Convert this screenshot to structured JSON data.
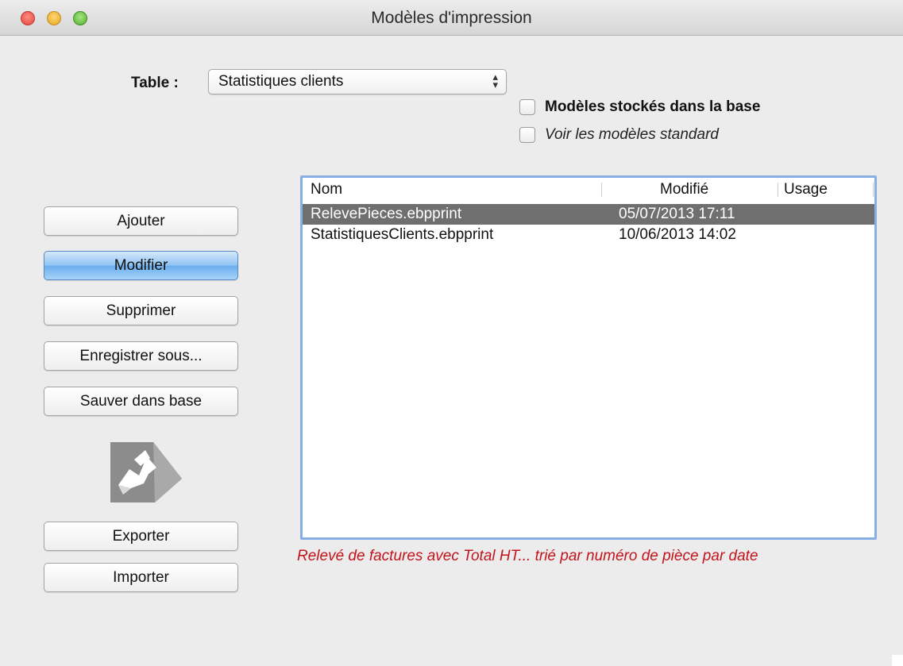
{
  "window": {
    "title": "Modèles d'impression"
  },
  "table_selector": {
    "label": "Table :",
    "selected": "Statistiques clients"
  },
  "options": {
    "stored_in_db": {
      "label": "Modèles stockés dans la base",
      "checked": false
    },
    "show_standard": {
      "label": "Voir les modèles standard",
      "checked": false
    }
  },
  "buttons": {
    "add": "Ajouter",
    "modify": "Modifier",
    "delete": "Supprimer",
    "save_as": "Enregistrer sous...",
    "save_in_db": "Sauver dans base",
    "export": "Exporter",
    "import": "Importer"
  },
  "icons": {
    "export_import": "export-arrow-icon"
  },
  "list": {
    "columns": [
      "Nom",
      "Modifié",
      "Usage"
    ],
    "rows": [
      {
        "name": "RelevePieces.ebpprint",
        "modified": "05/07/2013 17:11",
        "usage": "",
        "selected": true
      },
      {
        "name": "StatistiquesClients.ebpprint",
        "modified": "10/06/2013 14:02",
        "usage": "",
        "selected": false
      }
    ]
  },
  "description": "Relevé de factures avec Total HT... trié par numéro de pièce par date",
  "colors": {
    "selection": "#6f6f6f",
    "description_text": "#c3141c",
    "focus_ring": "#86b0e3",
    "default_button": "#8fc3f2"
  }
}
